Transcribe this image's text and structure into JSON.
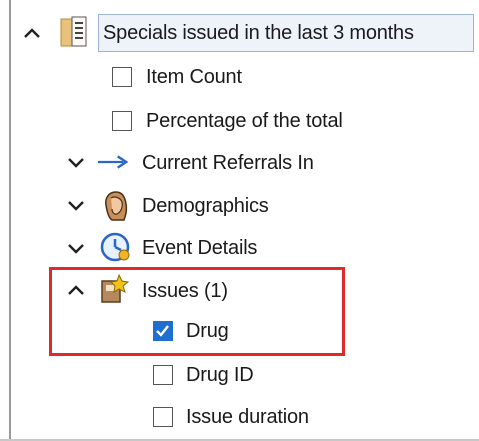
{
  "tree": {
    "root": {
      "label": "Specials issued in the last 3 months",
      "expanded": true,
      "icon": "report-icon",
      "children": [
        {
          "label": "Item Count",
          "checked": false
        },
        {
          "label": "Percentage of the total",
          "checked": false
        }
      ]
    },
    "groups": [
      {
        "label": "Current Referrals In",
        "icon": "arrow-right-icon",
        "expanded": false
      },
      {
        "label": "Demographics",
        "icon": "person-head-icon",
        "expanded": false
      },
      {
        "label": "Event Details",
        "icon": "clock-event-icon",
        "expanded": false
      },
      {
        "label": "Issues (1)",
        "icon": "issues-icon",
        "expanded": true,
        "children": [
          {
            "label": "Drug",
            "checked": true
          },
          {
            "label": "Drug ID",
            "checked": false
          },
          {
            "label": "Issue duration",
            "checked": false
          }
        ]
      }
    ]
  },
  "colors": {
    "highlight_border": "#e02929",
    "checkbox_checked": "#1e6fd0",
    "arrow_blue": "#2a66c9"
  }
}
